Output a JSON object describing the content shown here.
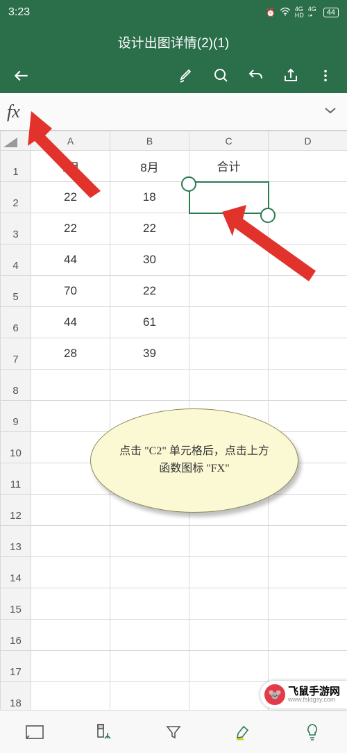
{
  "status": {
    "time": "3:23",
    "battery": "44"
  },
  "title": "设计出图详情(2)(1)",
  "formula": {
    "fx": "fx"
  },
  "columns": [
    "A",
    "B",
    "C",
    "D"
  ],
  "rows": [
    "1",
    "2",
    "3",
    "4",
    "5",
    "6",
    "7",
    "8",
    "9",
    "10",
    "11",
    "12",
    "13",
    "14",
    "15",
    "16",
    "17",
    "18"
  ],
  "cells": {
    "A1": "7月",
    "B1": "8月",
    "C1": "合计",
    "A2": "22",
    "B2": "18",
    "A3": "22",
    "B3": "22",
    "A4": "44",
    "B4": "30",
    "A5": "70",
    "B5": "22",
    "A6": "44",
    "B6": "61",
    "A7": "28",
    "B7": "39"
  },
  "callout": "点击 \"C2\" 单元格后，点击上方函数图标 \"FX\"",
  "watermark": {
    "name": "飞鼠手游网",
    "url": "www.fsktgsy.com"
  },
  "selection": {
    "col": "C",
    "row": "2",
    "cell": "C2"
  }
}
